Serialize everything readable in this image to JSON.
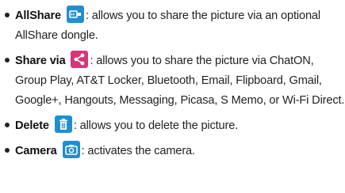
{
  "colors": {
    "icon_allshare": "#1f8fd2",
    "icon_share": "#d8347a",
    "icon_delete": "#1f8fd2",
    "icon_camera": "#1f8fd2",
    "text": "#222222"
  },
  "items": [
    {
      "term": "AllShare",
      "icon": "allshare-icon",
      "description": ": allows you to share the picture via an optional AllShare dongle."
    },
    {
      "term": "Share via",
      "icon": "share-icon",
      "description": ": allows you to share the picture via ChatON, Group Play, AT&T Locker, Bluetooth, Email, Flipboard, Gmail, Google+, Hangouts, Messaging, Picasa, S Memo, or Wi-Fi Direct."
    },
    {
      "term": "Delete",
      "icon": "trash-icon",
      "description": ": allows you to delete the picture."
    },
    {
      "term": "Camera",
      "icon": "camera-icon",
      "description": ": activates the camera."
    }
  ]
}
